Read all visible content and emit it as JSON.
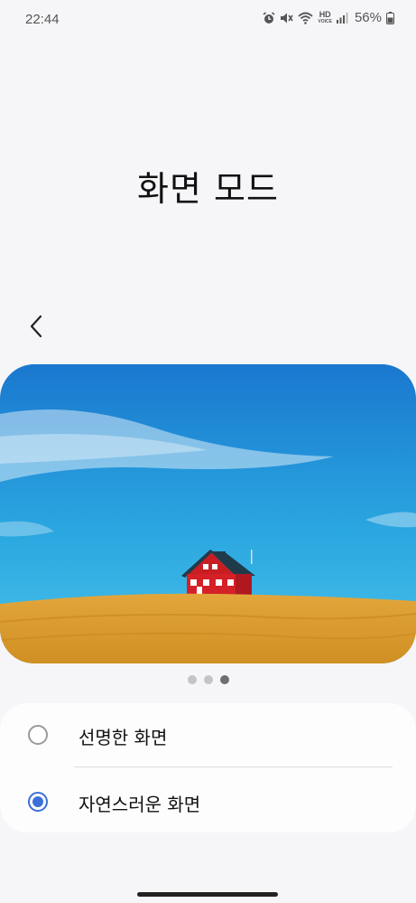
{
  "status_bar": {
    "time": "22:44",
    "hd_label": "HD",
    "voice_label": "VOICE",
    "battery_percent": "56%",
    "icons": [
      "alarm-icon",
      "mute-icon",
      "wifi-icon",
      "hd-voice-icon",
      "signal-icon",
      "battery-icon"
    ]
  },
  "header": {
    "title": "화면 모드"
  },
  "nav": {
    "back_icon": "chevron-left-icon"
  },
  "preview": {
    "description_icon": "preview-image",
    "page_count": 3,
    "active_page": 3
  },
  "options": [
    {
      "label": "선명한 화면",
      "selected": false
    },
    {
      "label": "자연스러운 화면",
      "selected": true
    }
  ],
  "colors": {
    "accent": "#3c6fd9",
    "background": "#f6f6f8",
    "card": "#fdfdfe"
  }
}
